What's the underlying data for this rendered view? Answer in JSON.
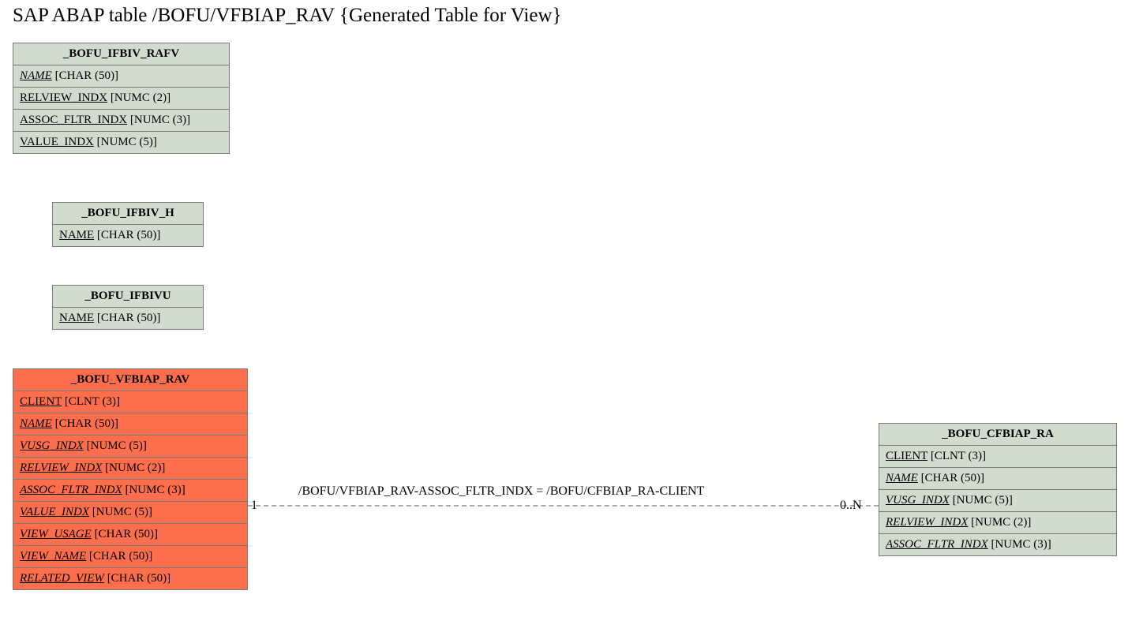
{
  "page_title": "SAP ABAP table /BOFU/VFBIAP_RAV {Generated Table for View}",
  "entities": {
    "e1": {
      "name": "_BOFU_IFBIV_RAFV",
      "fields": [
        {
          "name": "NAME",
          "type": "[CHAR (50)]",
          "italic": true
        },
        {
          "name": "RELVIEW_INDX",
          "type": "[NUMC (2)]",
          "italic": false
        },
        {
          "name": "ASSOC_FLTR_INDX",
          "type": "[NUMC (3)]",
          "italic": false
        },
        {
          "name": "VALUE_INDX",
          "type": "[NUMC (5)]",
          "italic": false
        }
      ]
    },
    "e2": {
      "name": "_BOFU_IFBIV_H",
      "fields": [
        {
          "name": "NAME",
          "type": "[CHAR (50)]",
          "italic": false
        }
      ]
    },
    "e3": {
      "name": "_BOFU_IFBIVU",
      "fields": [
        {
          "name": "NAME",
          "type": "[CHAR (50)]",
          "italic": false
        }
      ]
    },
    "e4": {
      "name": "_BOFU_VFBIAP_RAV",
      "fields": [
        {
          "name": "CLIENT",
          "type": "[CLNT (3)]",
          "italic": false
        },
        {
          "name": "NAME",
          "type": "[CHAR (50)]",
          "italic": true
        },
        {
          "name": "VUSG_INDX",
          "type": "[NUMC (5)]",
          "italic": true
        },
        {
          "name": "RELVIEW_INDX",
          "type": "[NUMC (2)]",
          "italic": true
        },
        {
          "name": "ASSOC_FLTR_INDX",
          "type": "[NUMC (3)]",
          "italic": true
        },
        {
          "name": "VALUE_INDX",
          "type": "[NUMC (5)]",
          "italic": true
        },
        {
          "name": "VIEW_USAGE",
          "type": "[CHAR (50)]",
          "italic": true
        },
        {
          "name": "VIEW_NAME",
          "type": "[CHAR (50)]",
          "italic": true
        },
        {
          "name": "RELATED_VIEW",
          "type": "[CHAR (50)]",
          "italic": true
        }
      ]
    },
    "e5": {
      "name": "_BOFU_CFBIAP_RA",
      "fields": [
        {
          "name": "CLIENT",
          "type": "[CLNT (3)]",
          "italic": false
        },
        {
          "name": "NAME",
          "type": "[CHAR (50)]",
          "italic": true
        },
        {
          "name": "VUSG_INDX",
          "type": "[NUMC (5)]",
          "italic": true
        },
        {
          "name": "RELVIEW_INDX",
          "type": "[NUMC (2)]",
          "italic": true
        },
        {
          "name": "ASSOC_FLTR_INDX",
          "type": "[NUMC (3)]",
          "italic": true
        }
      ]
    }
  },
  "relationship": {
    "left_card": "1",
    "right_card": "0..N",
    "label": "/BOFU/VFBIAP_RAV-ASSOC_FLTR_INDX = /BOFU/CFBIAP_RA-CLIENT"
  }
}
